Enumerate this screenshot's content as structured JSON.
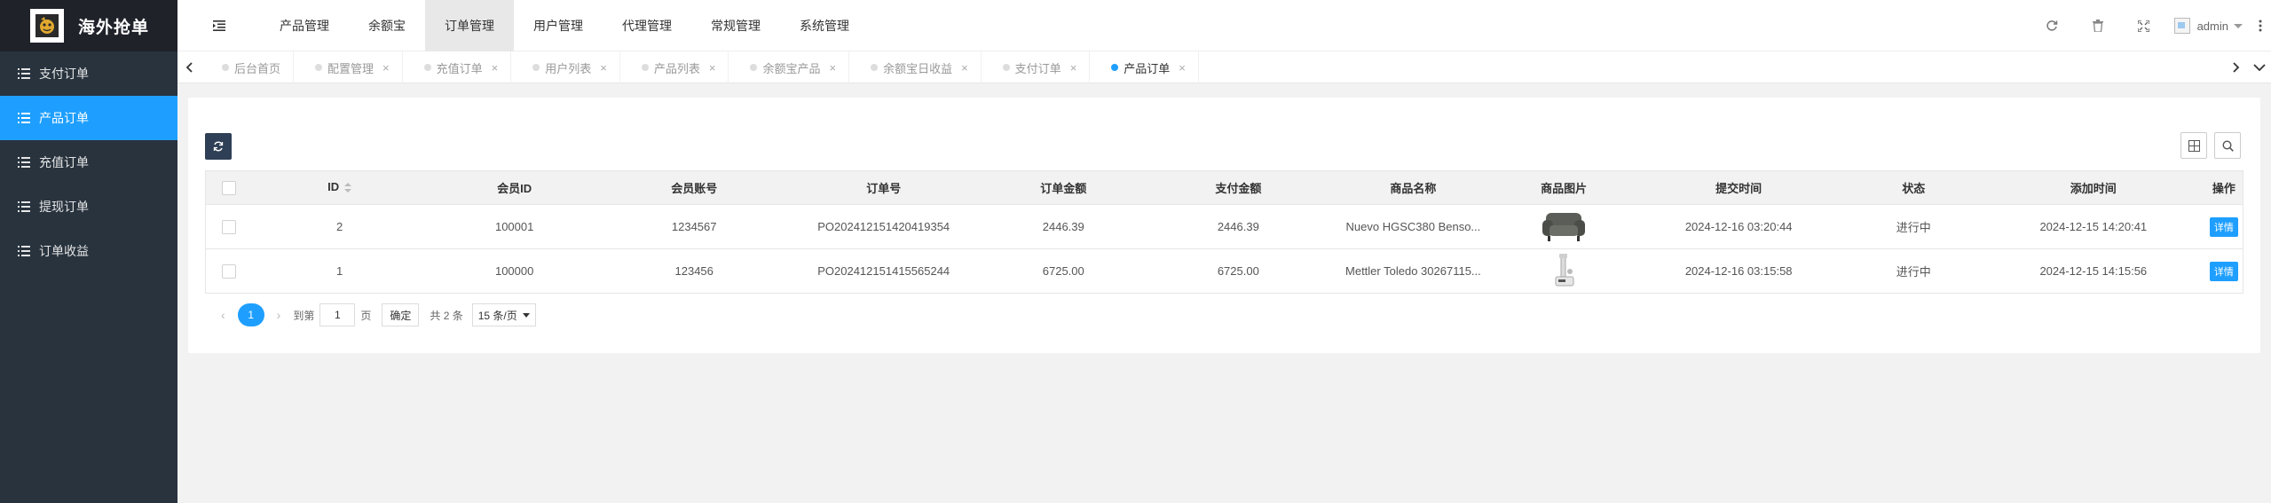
{
  "app": {
    "title": "海外抢单",
    "accent": "#1e9fff",
    "sidebar_bg": "#28333e"
  },
  "sidebar": {
    "items": [
      {
        "label": "支付订单",
        "active": false
      },
      {
        "label": "产品订单",
        "active": true
      },
      {
        "label": "充值订单",
        "active": false
      },
      {
        "label": "提现订单",
        "active": false
      },
      {
        "label": "订单收益",
        "active": false
      }
    ]
  },
  "topnav": {
    "items": [
      {
        "label": "产品管理",
        "active": false
      },
      {
        "label": "余额宝",
        "active": false
      },
      {
        "label": "订单管理",
        "active": true
      },
      {
        "label": "用户管理",
        "active": false
      },
      {
        "label": "代理管理",
        "active": false
      },
      {
        "label": "常规管理",
        "active": false
      },
      {
        "label": "系统管理",
        "active": false
      }
    ]
  },
  "header": {
    "username": "admin"
  },
  "tabs": [
    {
      "label": "后台首页",
      "closable": false,
      "active": false
    },
    {
      "label": "配置管理",
      "closable": true,
      "active": false
    },
    {
      "label": "充值订单",
      "closable": true,
      "active": false
    },
    {
      "label": "用户列表",
      "closable": true,
      "active": false
    },
    {
      "label": "产品列表",
      "closable": true,
      "active": false
    },
    {
      "label": "余额宝产品",
      "closable": true,
      "active": false
    },
    {
      "label": "余额宝日收益",
      "closable": true,
      "active": false
    },
    {
      "label": "支付订单",
      "closable": true,
      "active": false
    },
    {
      "label": "产品订单",
      "closable": true,
      "active": true
    }
  ],
  "table": {
    "columns": [
      "ID",
      "会员ID",
      "会员账号",
      "订单号",
      "订单金额",
      "支付金额",
      "商品名称",
      "商品图片",
      "提交时间",
      "状态",
      "添加时间",
      "操作"
    ],
    "rows": [
      {
        "id": "2",
        "member_id": "100001",
        "account": "1234567",
        "order_no": "PO202412151420419354",
        "order_amount": "2446.39",
        "pay_amount": "2446.39",
        "product_name": "Nuevo HGSC380 Benso...",
        "image": "sofa-chair",
        "submit_time": "2024-12-16 03:20:44",
        "status": "进行中",
        "add_time": "2024-12-15 14:20:41",
        "action": "详情"
      },
      {
        "id": "1",
        "member_id": "100000",
        "account": "123456",
        "order_no": "PO202412151415565244",
        "order_amount": "6725.00",
        "pay_amount": "6725.00",
        "product_name": "Mettler Toledo 30267115...",
        "image": "lab-balance",
        "submit_time": "2024-12-16 03:15:58",
        "status": "进行中",
        "add_time": "2024-12-15 14:15:56",
        "action": "详情"
      }
    ]
  },
  "pager": {
    "current": "1",
    "goto_prefix": "到第",
    "goto_value": "1",
    "goto_suffix": "页",
    "confirm": "确定",
    "total": "共 2 条",
    "page_size": "15 条/页"
  }
}
